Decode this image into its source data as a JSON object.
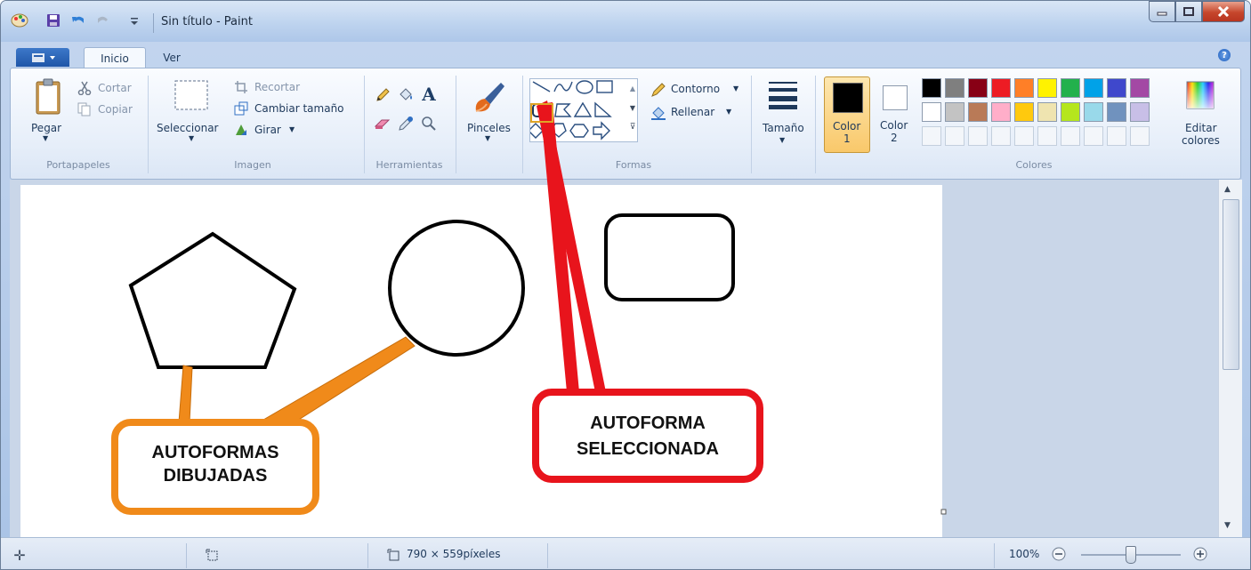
{
  "window": {
    "title": "Sin título - Paint"
  },
  "tabs": [
    {
      "label": "Inicio",
      "active": true
    },
    {
      "label": "Ver",
      "active": false
    }
  ],
  "ribbon": {
    "clipboard": {
      "paste_label": "Pegar",
      "cut_label": "Cortar",
      "copy_label": "Copiar",
      "group_label": "Portapapeles"
    },
    "image": {
      "select_label": "Seleccionar",
      "crop_label": "Recortar",
      "resize_label": "Cambiar tamaño",
      "rotate_label": "Girar",
      "group_label": "Imagen"
    },
    "tools": {
      "group_label": "Herramientas",
      "items": [
        "pencil-icon",
        "fill-icon",
        "text-icon",
        "eraser-icon",
        "color-picker-icon",
        "magnifier-icon"
      ]
    },
    "brushes": {
      "label": "Pinceles"
    },
    "shapes": {
      "outline_label": "Contorno",
      "fill_label": "Rellenar",
      "group_label": "Formas"
    },
    "size": {
      "label": "Tamaño"
    },
    "color1": {
      "label_line1": "Color",
      "label_line2": "1",
      "color": "#000000"
    },
    "color2": {
      "label_line1": "Color",
      "label_line2": "2",
      "color": "#ffffff"
    },
    "palette": {
      "row1": [
        "#000000",
        "#7f7f7f",
        "#880015",
        "#ed1c24",
        "#ff7f27",
        "#fff200",
        "#22b14c",
        "#00a2e8",
        "#3f48cc",
        "#a349a4"
      ],
      "row2": [
        "#ffffff",
        "#c3c3c3",
        "#b97a57",
        "#ffaec9",
        "#ffc90e",
        "#efe4b0",
        "#b5e61d",
        "#99d9ea",
        "#7092be",
        "#c8bfe7"
      ],
      "group_label": "Colores"
    },
    "edit_colors": {
      "label_line1": "Editar",
      "label_line2": "colores"
    }
  },
  "callouts": {
    "drawn": {
      "line1": "AUTOFORMAS",
      "line2": "DIBUJADAS",
      "color": "#f08a1a"
    },
    "selected": {
      "line1": "AUTOFORMA",
      "line2": "SELECCIONADA",
      "color": "#e8141c"
    }
  },
  "status": {
    "canvas_size": "790 × 559píxeles",
    "zoom": "100%"
  }
}
